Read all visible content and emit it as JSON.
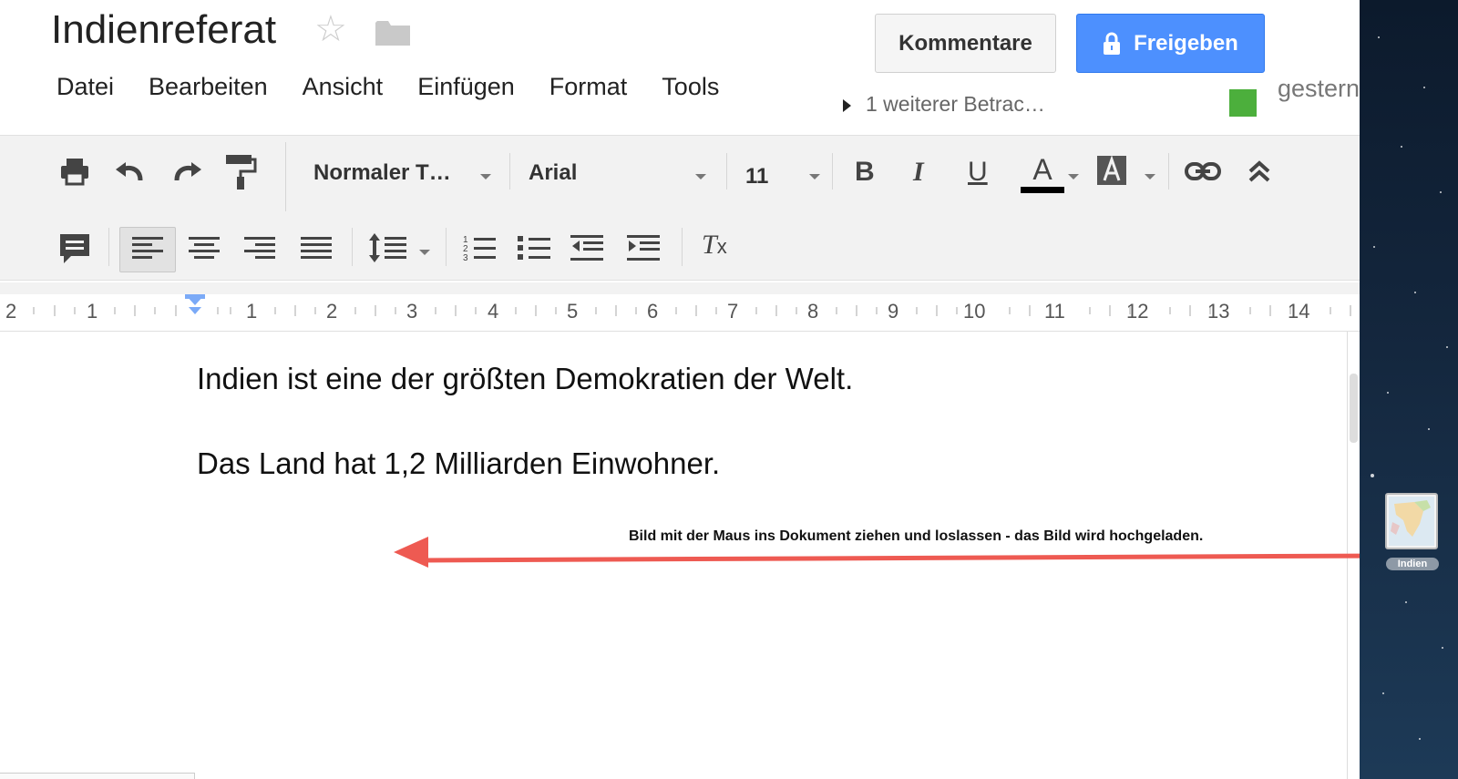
{
  "doc": {
    "title": "Indienreferat",
    "comments_label": "Kommentare",
    "share_label": "Freigeben",
    "viewer_text": "1 weiterer Betrac…",
    "last_edit_text": "gestern"
  },
  "menu": [
    "Datei",
    "Bearbeiten",
    "Ansicht",
    "Einfügen",
    "Format",
    "Tools"
  ],
  "toolbar": {
    "style_value": "Normaler T…",
    "font_value": "Arial",
    "size_value": "11"
  },
  "ruler": {
    "labels": [
      "2",
      "1",
      "1",
      "2",
      "3",
      "4",
      "5",
      "6",
      "7",
      "8",
      "9",
      "10",
      "11",
      "12",
      "13",
      "14"
    ]
  },
  "content": {
    "paragraphs": [
      "Indien ist eine der größten Demokratien der Welt.",
      "Das Land hat 1,2 Milliarden Einwohner."
    ],
    "annotation": "Bild mit der Maus ins Dokument ziehen und loslassen - das Bild wird hochgeladen."
  },
  "desktop": {
    "file_label": "Indien"
  },
  "colors": {
    "share_button": "#4d90fe",
    "annotation_arrow": "#ee5a52",
    "viewer_color": "#4caf3c"
  },
  "icons": [
    "star-icon",
    "folder-icon",
    "lock-icon",
    "print-icon",
    "undo-icon",
    "redo-icon",
    "paint-format-icon",
    "bold-icon",
    "italic-icon",
    "underline-icon",
    "text-color-icon",
    "highlight-color-icon",
    "link-icon",
    "collapse-icon",
    "comment-icon",
    "align-left-icon",
    "align-center-icon",
    "align-right-icon",
    "align-justify-icon",
    "line-spacing-icon",
    "numbered-list-icon",
    "bulleted-list-icon",
    "decrease-indent-icon",
    "increase-indent-icon",
    "clear-formatting-icon"
  ]
}
